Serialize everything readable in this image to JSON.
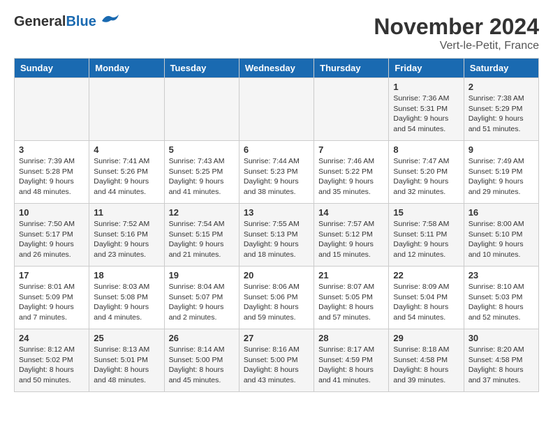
{
  "header": {
    "logo_general": "General",
    "logo_blue": "Blue",
    "month_title": "November 2024",
    "location": "Vert-le-Petit, France"
  },
  "days_of_week": [
    "Sunday",
    "Monday",
    "Tuesday",
    "Wednesday",
    "Thursday",
    "Friday",
    "Saturday"
  ],
  "weeks": [
    [
      {
        "day": "",
        "info": ""
      },
      {
        "day": "",
        "info": ""
      },
      {
        "day": "",
        "info": ""
      },
      {
        "day": "",
        "info": ""
      },
      {
        "day": "",
        "info": ""
      },
      {
        "day": "1",
        "info": "Sunrise: 7:36 AM\nSunset: 5:31 PM\nDaylight: 9 hours and 54 minutes."
      },
      {
        "day": "2",
        "info": "Sunrise: 7:38 AM\nSunset: 5:29 PM\nDaylight: 9 hours and 51 minutes."
      }
    ],
    [
      {
        "day": "3",
        "info": "Sunrise: 7:39 AM\nSunset: 5:28 PM\nDaylight: 9 hours and 48 minutes."
      },
      {
        "day": "4",
        "info": "Sunrise: 7:41 AM\nSunset: 5:26 PM\nDaylight: 9 hours and 44 minutes."
      },
      {
        "day": "5",
        "info": "Sunrise: 7:43 AM\nSunset: 5:25 PM\nDaylight: 9 hours and 41 minutes."
      },
      {
        "day": "6",
        "info": "Sunrise: 7:44 AM\nSunset: 5:23 PM\nDaylight: 9 hours and 38 minutes."
      },
      {
        "day": "7",
        "info": "Sunrise: 7:46 AM\nSunset: 5:22 PM\nDaylight: 9 hours and 35 minutes."
      },
      {
        "day": "8",
        "info": "Sunrise: 7:47 AM\nSunset: 5:20 PM\nDaylight: 9 hours and 32 minutes."
      },
      {
        "day": "9",
        "info": "Sunrise: 7:49 AM\nSunset: 5:19 PM\nDaylight: 9 hours and 29 minutes."
      }
    ],
    [
      {
        "day": "10",
        "info": "Sunrise: 7:50 AM\nSunset: 5:17 PM\nDaylight: 9 hours and 26 minutes."
      },
      {
        "day": "11",
        "info": "Sunrise: 7:52 AM\nSunset: 5:16 PM\nDaylight: 9 hours and 23 minutes."
      },
      {
        "day": "12",
        "info": "Sunrise: 7:54 AM\nSunset: 5:15 PM\nDaylight: 9 hours and 21 minutes."
      },
      {
        "day": "13",
        "info": "Sunrise: 7:55 AM\nSunset: 5:13 PM\nDaylight: 9 hours and 18 minutes."
      },
      {
        "day": "14",
        "info": "Sunrise: 7:57 AM\nSunset: 5:12 PM\nDaylight: 9 hours and 15 minutes."
      },
      {
        "day": "15",
        "info": "Sunrise: 7:58 AM\nSunset: 5:11 PM\nDaylight: 9 hours and 12 minutes."
      },
      {
        "day": "16",
        "info": "Sunrise: 8:00 AM\nSunset: 5:10 PM\nDaylight: 9 hours and 10 minutes."
      }
    ],
    [
      {
        "day": "17",
        "info": "Sunrise: 8:01 AM\nSunset: 5:09 PM\nDaylight: 9 hours and 7 minutes."
      },
      {
        "day": "18",
        "info": "Sunrise: 8:03 AM\nSunset: 5:08 PM\nDaylight: 9 hours and 4 minutes."
      },
      {
        "day": "19",
        "info": "Sunrise: 8:04 AM\nSunset: 5:07 PM\nDaylight: 9 hours and 2 minutes."
      },
      {
        "day": "20",
        "info": "Sunrise: 8:06 AM\nSunset: 5:06 PM\nDaylight: 8 hours and 59 minutes."
      },
      {
        "day": "21",
        "info": "Sunrise: 8:07 AM\nSunset: 5:05 PM\nDaylight: 8 hours and 57 minutes."
      },
      {
        "day": "22",
        "info": "Sunrise: 8:09 AM\nSunset: 5:04 PM\nDaylight: 8 hours and 54 minutes."
      },
      {
        "day": "23",
        "info": "Sunrise: 8:10 AM\nSunset: 5:03 PM\nDaylight: 8 hours and 52 minutes."
      }
    ],
    [
      {
        "day": "24",
        "info": "Sunrise: 8:12 AM\nSunset: 5:02 PM\nDaylight: 8 hours and 50 minutes."
      },
      {
        "day": "25",
        "info": "Sunrise: 8:13 AM\nSunset: 5:01 PM\nDaylight: 8 hours and 48 minutes."
      },
      {
        "day": "26",
        "info": "Sunrise: 8:14 AM\nSunset: 5:00 PM\nDaylight: 8 hours and 45 minutes."
      },
      {
        "day": "27",
        "info": "Sunrise: 8:16 AM\nSunset: 5:00 PM\nDaylight: 8 hours and 43 minutes."
      },
      {
        "day": "28",
        "info": "Sunrise: 8:17 AM\nSunset: 4:59 PM\nDaylight: 8 hours and 41 minutes."
      },
      {
        "day": "29",
        "info": "Sunrise: 8:18 AM\nSunset: 4:58 PM\nDaylight: 8 hours and 39 minutes."
      },
      {
        "day": "30",
        "info": "Sunrise: 8:20 AM\nSunset: 4:58 PM\nDaylight: 8 hours and 37 minutes."
      }
    ]
  ]
}
